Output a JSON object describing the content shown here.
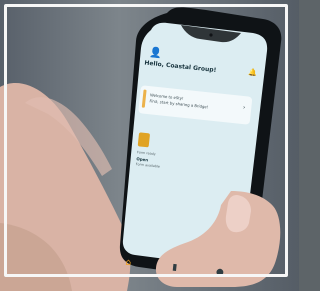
{
  "screen": {
    "greeting": "Hello, Coastal Group!",
    "welcome_card": {
      "line1": "Welcome to eSty!",
      "line2": "First, start by sharing a Bridge!"
    },
    "document": {
      "line1": "Form ready",
      "status": "Open",
      "line3": "Form available"
    },
    "icons": {
      "avatar": "user-avatar-icon",
      "header_action": "bell-icon",
      "home": "home-icon",
      "documents": "document-icon",
      "profile": "person-icon"
    },
    "accent_color": "#f1a21d",
    "screen_color": "#dfeff4"
  }
}
